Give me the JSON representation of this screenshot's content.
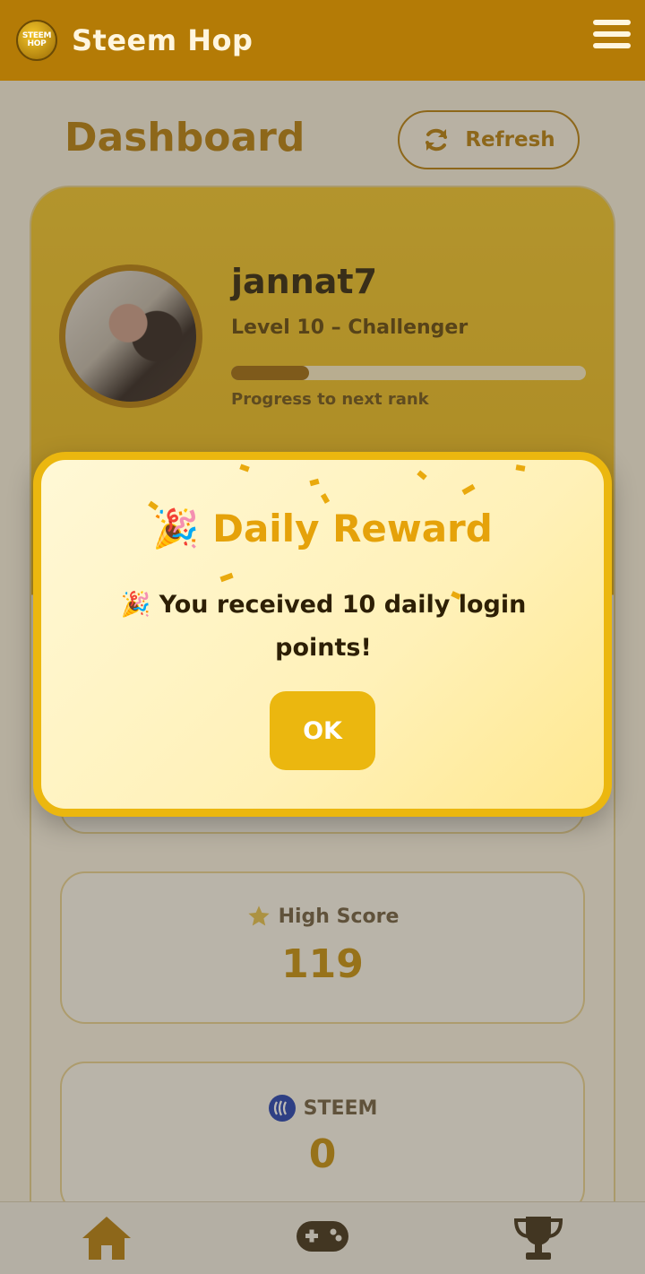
{
  "app": {
    "title": "Steem Hop",
    "logo_text_line1": "STEEM",
    "logo_text_line2": "HOP"
  },
  "dashboard": {
    "title": "Dashboard",
    "refresh_label": "Refresh"
  },
  "profile": {
    "username": "jannat7",
    "level_text": "Level 10 – Challenger",
    "progress_fraction": 0.22,
    "progress_label": "Progress to next rank"
  },
  "stats": {
    "high_score_label": "High Score",
    "high_score_value": "119",
    "steem_label": "STEEM",
    "steem_value": "0"
  },
  "modal": {
    "title_emoji": "🎉",
    "title": "Daily Reward",
    "message_emoji": "🎉",
    "message": "You received 10 daily login points!",
    "ok_label": "OK"
  },
  "nav": {
    "items": [
      "home-icon",
      "gamepad-icon",
      "trophy-icon"
    ]
  },
  "colors": {
    "brand": "#b47b06",
    "accent": "#ebb70f",
    "gold_text": "#c48d06"
  }
}
